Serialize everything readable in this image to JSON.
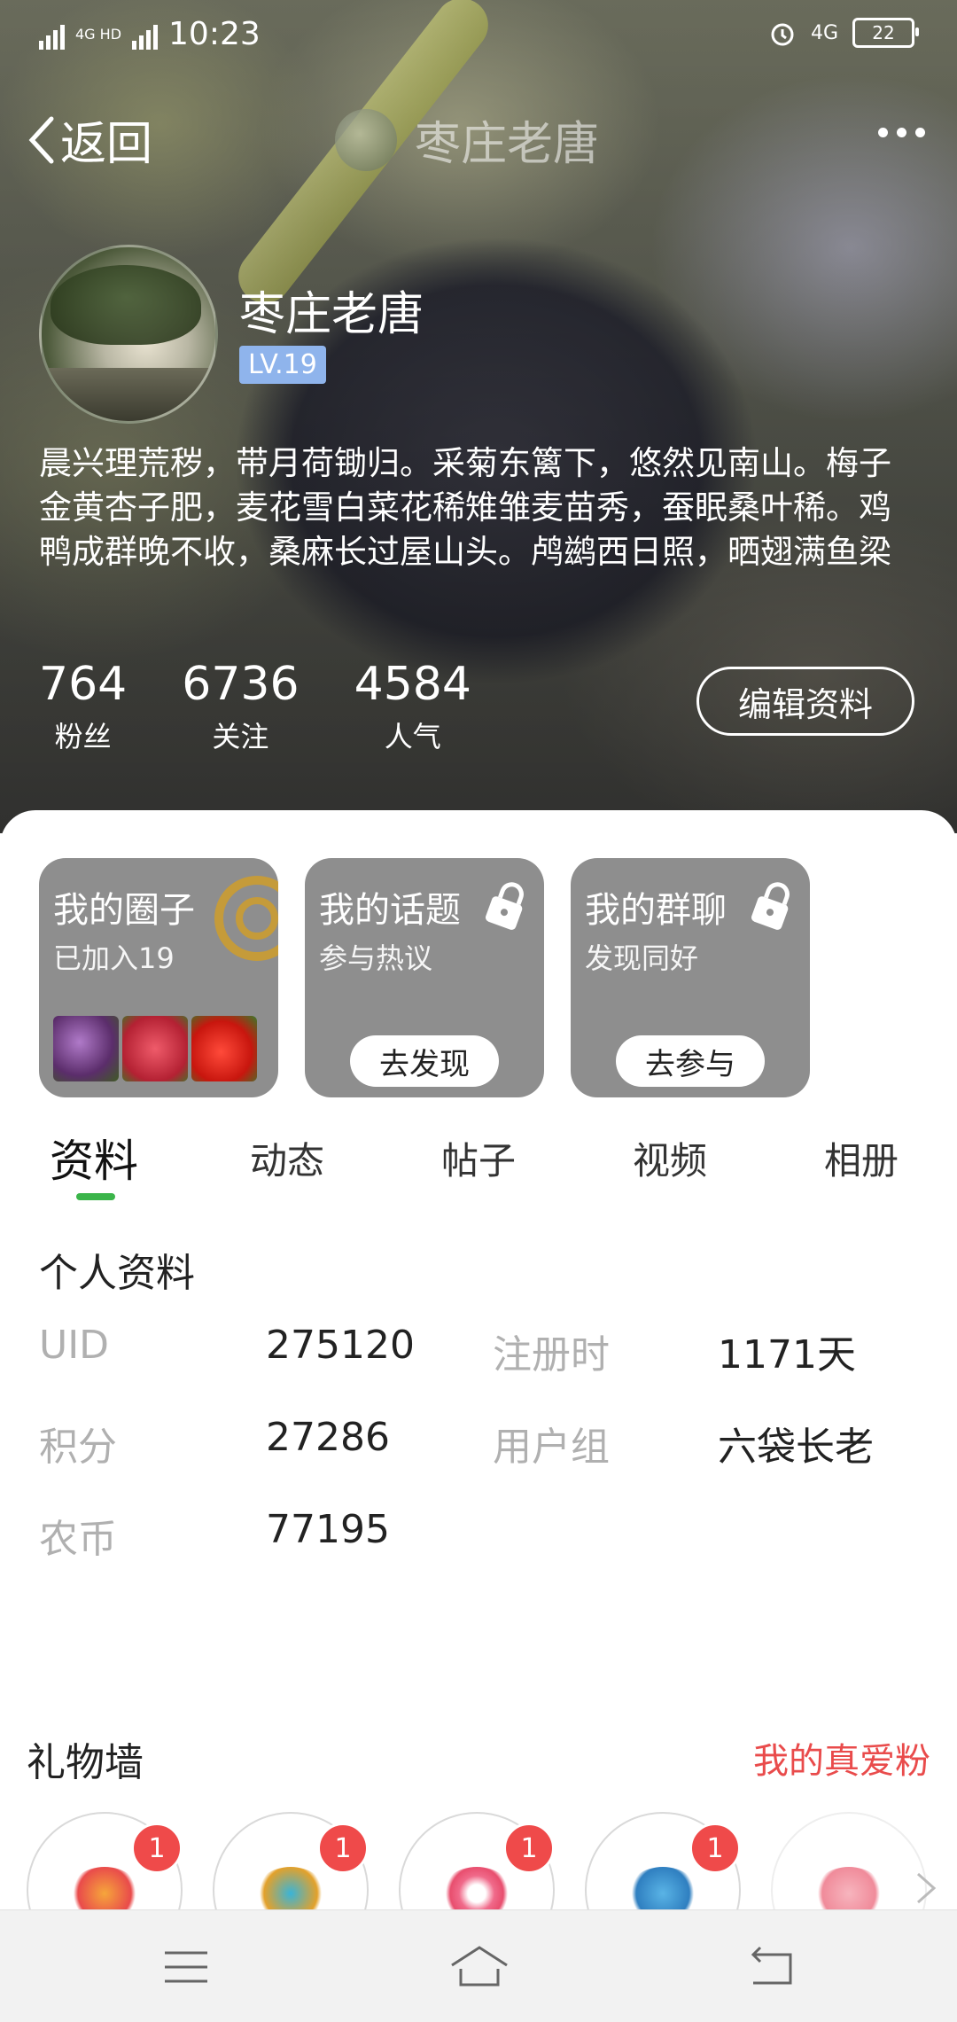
{
  "status_bar": {
    "time": "10:23",
    "net_left": "4G HD",
    "net_right": "4G",
    "battery": "22"
  },
  "nav": {
    "back_label": "返回",
    "title": "枣庄老唐"
  },
  "profile": {
    "name": "枣庄老唐",
    "level": "LV.19",
    "bio": "晨兴理荒秽，带月荷锄归。采菊东篱下，悠然见南山。梅子金黄杏子肥，麦花雪白菜花稀雉雏麦苗秀，蚕眠桑叶稀。鸡鸭成群晚不收，桑麻长过屋山头。鸬鹚西日照，晒翅满鱼梁",
    "stats": [
      {
        "value": "764",
        "label": "粉丝"
      },
      {
        "value": "6736",
        "label": "关注"
      },
      {
        "value": "4584",
        "label": "人气"
      }
    ],
    "edit_button": "编辑资料"
  },
  "cards": [
    {
      "title": "我的圈子",
      "subtitle": "已加入19"
    },
    {
      "title": "我的话题",
      "subtitle": "参与热议",
      "button": "去发现"
    },
    {
      "title": "我的群聊",
      "subtitle": "发现同好",
      "button": "去参与"
    }
  ],
  "tabs": [
    "资料",
    "动态",
    "帖子",
    "视频",
    "相册"
  ],
  "active_tab": "资料",
  "personal_info": {
    "title": "个人资料",
    "rows": [
      {
        "k1": "UID",
        "v1": "275120",
        "k2": "注册时",
        "v2": "1171天"
      },
      {
        "k1": "积分",
        "v1": "27286",
        "k2": "用户组",
        "v2": "六袋长老"
      },
      {
        "k1": "农币",
        "v1": "77195"
      }
    ]
  },
  "gift_wall": {
    "title": "礼物墙",
    "link": "我的真爱粉",
    "gifts": [
      {
        "icon": "party-popper-icon",
        "count": "1"
      },
      {
        "icon": "diamond-ring-icon",
        "count": "1"
      },
      {
        "icon": "lollipop-icon",
        "count": "1"
      },
      {
        "icon": "cool-sticker-icon",
        "count": "1"
      },
      {
        "icon": "rose-icon"
      }
    ]
  },
  "colors": {
    "accent_green": "#3bb54a",
    "link_red": "#e94b4b",
    "level_blue": "#8fb4ec",
    "card_gray": "#8e8e8e"
  }
}
